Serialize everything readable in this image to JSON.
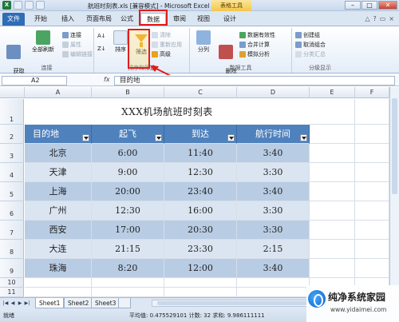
{
  "titlebar": {
    "app_icon": "X",
    "window_title": "航班时刻表.xls [兼容模式] - Microsoft Excel",
    "context_tab": "表格工具",
    "controls": [
      "–",
      "□",
      "✕"
    ]
  },
  "tabs": [
    "文件",
    "开始",
    "插入",
    "页面布局",
    "公式",
    "数据",
    "审阅",
    "视图",
    "设计"
  ],
  "ribbon": {
    "get_external": "获取\n外部数据",
    "refresh_all": "全部刷新",
    "connections": "连接",
    "properties": "属性",
    "edit_links": "编辑链接",
    "group_connections": "连接",
    "sort": "排序",
    "filter": "筛选",
    "clear": "清除",
    "reapply": "重新应用",
    "advanced": "高级",
    "group_sort_filter": "排序和筛选",
    "split": "分列",
    "remove_dup": "删除\n重复项",
    "data_validation": "数据有效性",
    "consolidate": "合并计算",
    "what_if": "模拟分析",
    "group_data_tools": "数据工具",
    "group": "创建组",
    "ungroup": "取消组合",
    "subtotal": "分类汇总",
    "group_outline": "分级显示"
  },
  "formula_bar": {
    "name_box": "A2",
    "fx": "fx",
    "content": "目的地"
  },
  "columns": [
    "A",
    "B",
    "C",
    "D",
    "E",
    "F"
  ],
  "rows": [
    "1",
    "2",
    "3",
    "4",
    "5",
    "6",
    "7",
    "8",
    "9",
    "10",
    "11"
  ],
  "sheet": {
    "title": "XXX机场航班时刻表",
    "headers": [
      "目的地",
      "起飞",
      "到达",
      "航行时间"
    ],
    "data": [
      [
        "北京",
        "6:00",
        "11:40",
        "3:40"
      ],
      [
        "天津",
        "9:00",
        "12:30",
        "3:30"
      ],
      [
        "上海",
        "20:00",
        "23:40",
        "3:40"
      ],
      [
        "广州",
        "12:30",
        "16:00",
        "3:30"
      ],
      [
        "西安",
        "17:00",
        "20:30",
        "3:30"
      ],
      [
        "大连",
        "21:15",
        "23:30",
        "2:15"
      ],
      [
        "珠海",
        "8:20",
        "12:00",
        "3:40"
      ]
    ]
  },
  "sheet_tabs": [
    "Sheet1",
    "Sheet2",
    "Sheet3"
  ],
  "statusbar": {
    "ready": "就绪",
    "stats": "平均值: 0.475529101   计数: 32   求和: 9.986111111"
  },
  "watermark": {
    "title": "纯净系统家园",
    "url": "www.yidaimei.com"
  }
}
